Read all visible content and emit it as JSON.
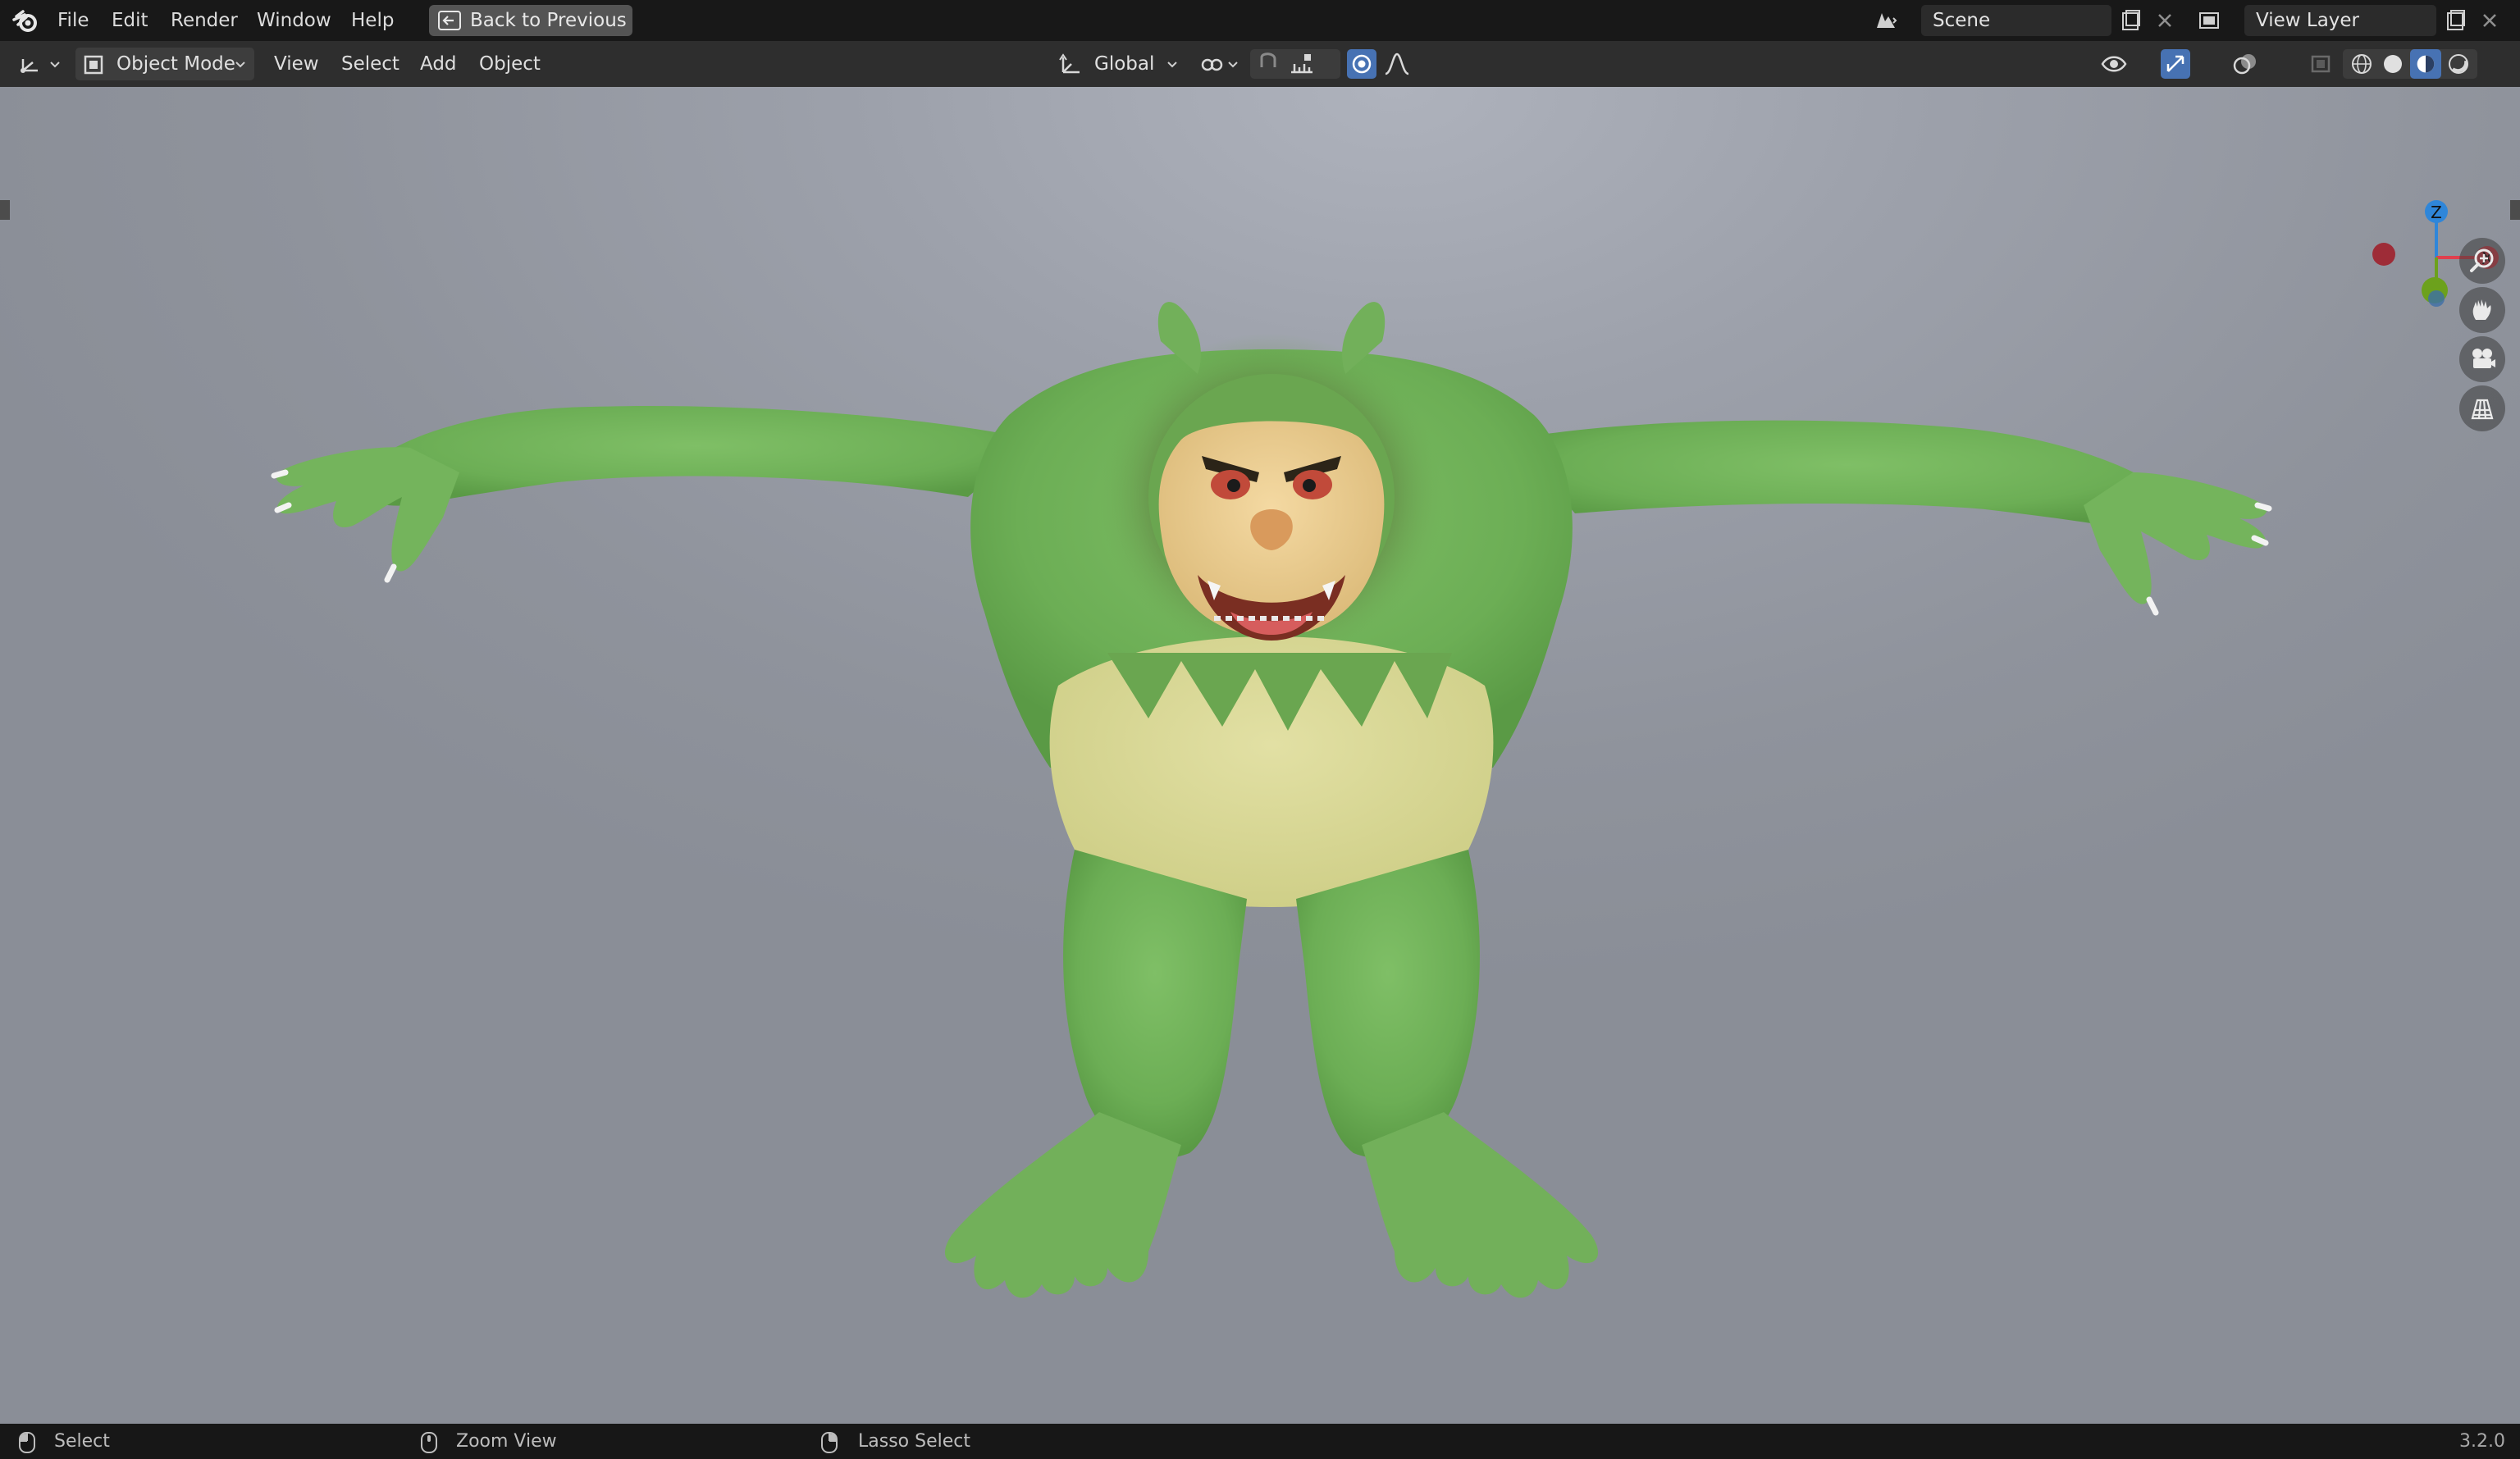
{
  "top_menu": {
    "items": [
      "File",
      "Edit",
      "Render",
      "Window",
      "Help"
    ],
    "back_button": "Back to Previous",
    "scene": "Scene",
    "view_layer": "View Layer"
  },
  "header": {
    "mode": "Object Mode",
    "menus": [
      "View",
      "Select",
      "Add",
      "Object"
    ],
    "orientation": "Global"
  },
  "gizmo": {
    "z": "Z",
    "x": "X"
  },
  "status": {
    "left": "Select",
    "middle": "Zoom View",
    "right": "Lasso Select",
    "version": "3.2.0"
  },
  "icons": {
    "logo": "blender-logo-icon",
    "back": "back-icon",
    "scene": "scene-icon",
    "view_layer": "view-layer-icon",
    "editor_type": "editor-type-icon",
    "object_mode": "object-mode-icon",
    "orientation": "transform-orientation-icon",
    "pivot": "pivot-point-icon",
    "snap": "snap-icon",
    "proportional": "proportional-edit-icon",
    "visibility": "visibility-icon",
    "gizmo": "gizmo-icon",
    "overlay": "overlay-icon",
    "xray": "xray-icon",
    "shading": [
      "wireframe-shading-icon",
      "solid-shading-icon",
      "material-shading-icon",
      "rendered-shading-icon"
    ],
    "navigation": [
      "zoom-icon",
      "pan-hand-icon",
      "camera-icon",
      "grid-view-icon"
    ]
  },
  "colors": {
    "accent_blue": "#4772b3",
    "axis_x": "#e0404e",
    "axis_y": "#6ca11c",
    "axis_z": "#2f86d9"
  }
}
